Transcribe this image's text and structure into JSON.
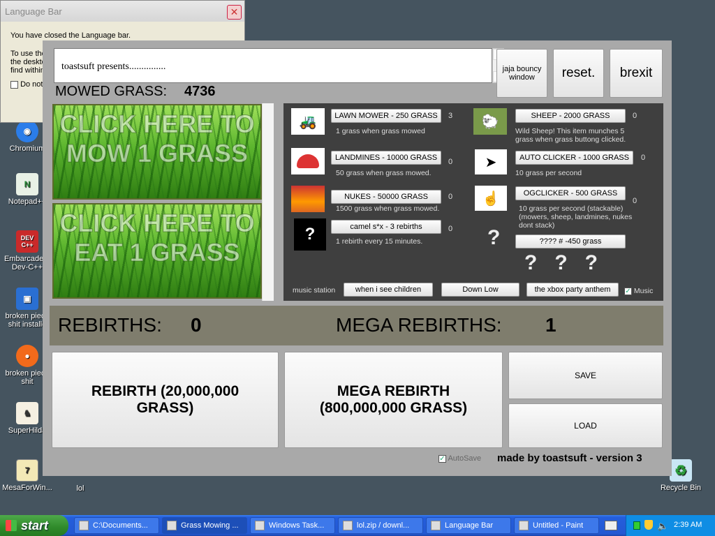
{
  "language_bar": {
    "title": "Language Bar",
    "line1": "You have closed the Language bar.",
    "line2a": "To use the",
    "line2b": "the deskto",
    "line2c": "find within",
    "checkbox": "Do not"
  },
  "desktop_icons": [
    {
      "label": "Chromium",
      "glyph": "◉",
      "color": "#2b7de9"
    },
    {
      "label": "Notepad++",
      "glyph": "N",
      "color": "#e8f1e6"
    },
    {
      "label": "Embarcadero Dev-C++",
      "glyph": "DEV C++",
      "color": "#c92a2a"
    },
    {
      "label": "broken piece shit installe",
      "glyph": "▣",
      "color": "#2a6fd2"
    },
    {
      "label": "broken piece shit",
      "glyph": "●",
      "color": "#f26a1b"
    },
    {
      "label": "SuperHilda",
      "glyph": "♞",
      "color": "#f5f0e2"
    },
    {
      "label": "MesaForWin...",
      "glyph": "7",
      "color": "#f3e9b6"
    },
    {
      "label": "lol",
      "glyph": "",
      "color": "#e9c96a"
    },
    {
      "label": "Recycle Bin",
      "glyph": "♻",
      "color": "#c9e6f5"
    }
  ],
  "game": {
    "presents_text": "toastsuft presents...............",
    "jaja_button": "jaja bouncy window",
    "reset_button": "reset.",
    "brexit_button": "brexit",
    "mowed_label": "MOWED GRASS:",
    "mowed_value": "4736",
    "mow_button": "CLICK HERE TO MOW 1 GRASS",
    "eat_button": "CLICK HERE TO EAT 1 GRASS",
    "shop": {
      "lawnmower": {
        "label": "LAWN MOWER - 250 GRASS",
        "desc": "1 grass when grass mowed",
        "count": "3"
      },
      "landmines": {
        "label": "LANDMINES - 10000 GRASS",
        "desc": "50 grass when grass mowed.",
        "count": "0"
      },
      "nukes": {
        "label": "NUKES - 50000 GRASS",
        "desc": "1500 grass when grass mowed.",
        "count": "0"
      },
      "camel": {
        "label": "camel s*x - 3 rebirths",
        "desc": "1 rebirth every 15 minutes.",
        "count": "0"
      },
      "sheep": {
        "label": "SHEEP - 2000 GRASS",
        "desc": "Wild Sheep! This item munches 5 grass when grass buttong clicked.",
        "count": "0"
      },
      "autoclicker": {
        "label": "AUTO CLICKER - 1000 GRASS",
        "desc": "10 grass per second",
        "count": "0"
      },
      "ogclicker": {
        "label": "OGCLICKER - 500 GRASS",
        "desc": "10 grass per second (stackable) (mowers, sheep, landmines, nukes dont stack)",
        "count": "0"
      },
      "mystery": {
        "label": "???? # -450 grass"
      },
      "qmarks": "?   ?   ?",
      "qmark_single": "?"
    },
    "music": {
      "station_label": "music station",
      "track1": "when i see children",
      "track2": "Down Low",
      "track3": "the xbox party anthem",
      "music_checkbox": "Music"
    },
    "rebirths_label": "REBIRTHS:",
    "rebirths_value": "0",
    "mega_rebirths_label": "MEGA REBIRTHS:",
    "mega_rebirths_value": "1",
    "rebirth_button": "REBIRTH (20,000,000 GRASS)",
    "mega_rebirth_button": "MEGA REBIRTH (800,000,000 GRASS)",
    "save_button": "SAVE",
    "load_button": "LOAD",
    "autosave_label": "AutoSave",
    "credit": "made by toastsuft - version 3"
  },
  "taskbar": {
    "start": "start",
    "tasks": [
      {
        "label": "C:\\Documents..."
      },
      {
        "label": "Grass Mowing ..."
      },
      {
        "label": "Windows Task..."
      },
      {
        "label": "lol.zip / downl..."
      },
      {
        "label": "Language Bar"
      },
      {
        "label": "Untitled - Paint"
      }
    ],
    "clock": "2:39 AM"
  }
}
